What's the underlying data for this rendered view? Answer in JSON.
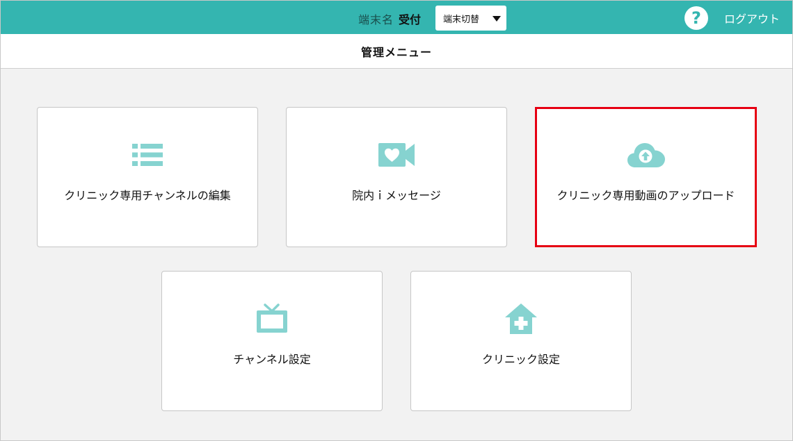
{
  "header": {
    "terminal_label": "端末名",
    "terminal_value": "受付",
    "switch_label": "端末切替",
    "help_icon": "question-circle-icon",
    "logout_label": "ログアウト",
    "accent_color": "#34b5b0"
  },
  "titlebar": {
    "title": "管理メニュー"
  },
  "menu": {
    "icon_color": "#86d3d0",
    "highlight_color": "#e60012",
    "items": [
      {
        "label": "クリニック専用チャンネルの編集",
        "icon": "list-icon",
        "highlighted": false
      },
      {
        "label": "院内ｉメッセージ",
        "icon": "video-heart-icon",
        "highlighted": false
      },
      {
        "label": "クリニック専用動画のアップロード",
        "icon": "cloud-upload-icon",
        "highlighted": true
      },
      {
        "label": "チャンネル設定",
        "icon": "tv-icon",
        "highlighted": false
      },
      {
        "label": "クリニック設定",
        "icon": "clinic-house-icon",
        "highlighted": false
      }
    ]
  }
}
